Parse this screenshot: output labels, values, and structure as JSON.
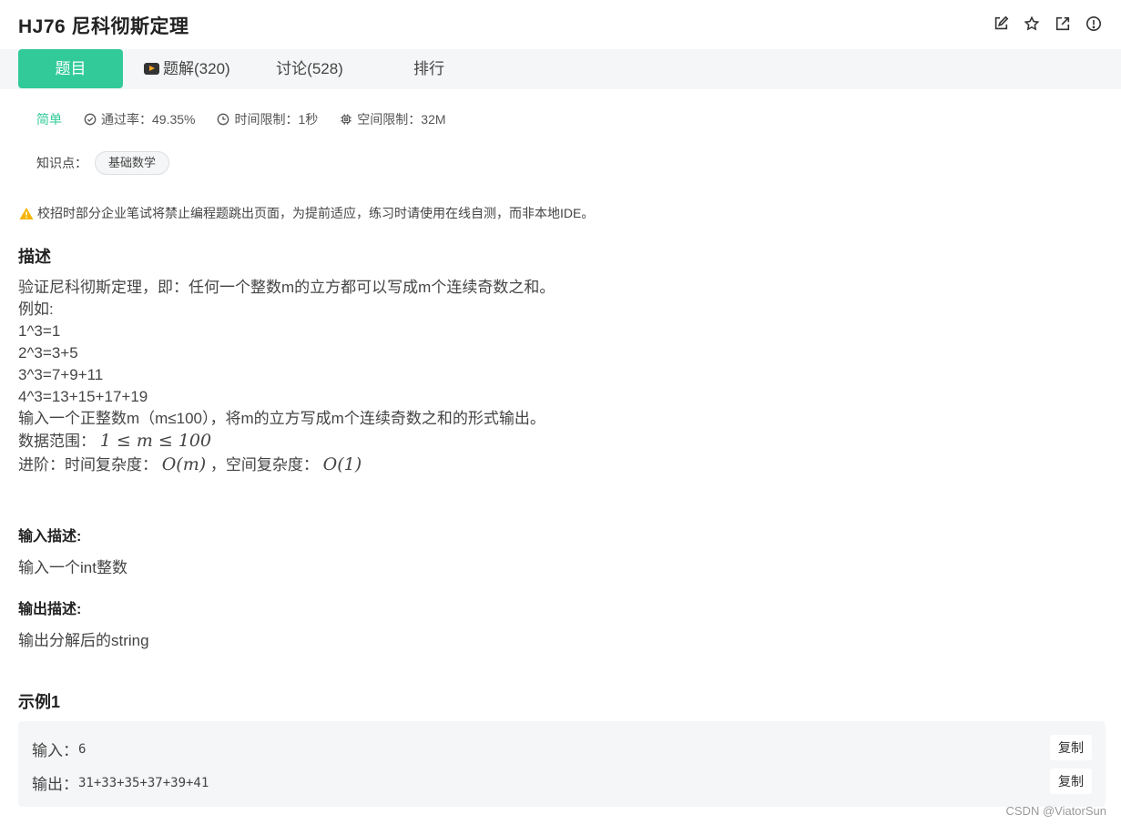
{
  "header": {
    "title": "HJ76  尼科彻斯定理",
    "icons": [
      "edit-icon",
      "star-icon",
      "share-icon",
      "info-icon"
    ]
  },
  "tabs": [
    {
      "label": "题目",
      "active": true
    },
    {
      "label": "题解(320)",
      "icon": "video-icon"
    },
    {
      "label": "讨论(528)"
    },
    {
      "label": "排行"
    }
  ],
  "meta": {
    "difficulty": "简单",
    "pass_rate": "通过率：49.35%",
    "time_limit": "时间限制：1秒",
    "space_limit": "空间限制：32M"
  },
  "knowledge": {
    "label": "知识点：",
    "tag": "基础数学"
  },
  "warning": "校招时部分企业笔试将禁止编程题跳出页面，为提前适应，练习时请使用在线自测，而非本地IDE。",
  "description": {
    "heading": "描述",
    "lines": [
      "验证尼科彻斯定理，即：任何一个整数m的立方都可以写成m个连续奇数之和。",
      "例如:",
      "1^3=1",
      "2^3=3+5",
      "3^3=7+9+11",
      "4^3=13+15+17+19",
      "输入一个正整数m（m≤100），将m的立方写成m个连续奇数之和的形式输出。"
    ],
    "range_label": "数据范围：",
    "range_math": "1 ≤ m ≤ 100",
    "advanced_label": "进阶：时间复杂度：",
    "time_complexity": "O(m)",
    "space_label": "，空间复杂度：",
    "space_complexity": "O(1)"
  },
  "input_desc": {
    "heading": "输入描述:",
    "text": "输入一个int整数"
  },
  "output_desc": {
    "heading": "输出描述:",
    "text": "输出分解后的string"
  },
  "example": {
    "heading": "示例1",
    "input_label": "输入：",
    "input_value": "6",
    "output_label": "输出：",
    "output_value": "31+33+35+37+39+41",
    "copy_label": "复制"
  },
  "watermark": "CSDN @ViatorSun",
  "colors": {
    "accent": "#32ca99",
    "tab_bar": "#f5f6f7",
    "warning": "#f5b400"
  }
}
